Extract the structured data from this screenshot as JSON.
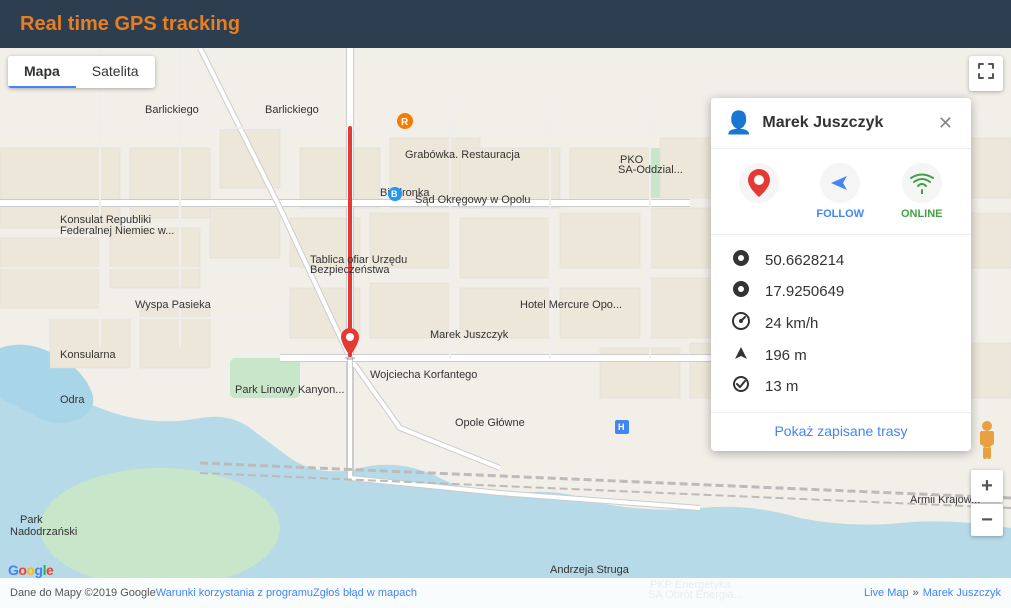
{
  "header": {
    "title": "Real time GPS tracking"
  },
  "map_tabs": [
    {
      "label": "Mapa",
      "active": true
    },
    {
      "label": "Satelita",
      "active": false
    }
  ],
  "info_panel": {
    "user_name": "Marek Juszczyk",
    "actions": [
      {
        "id": "location",
        "icon": "📍",
        "label": ""
      },
      {
        "id": "follow",
        "icon": "➤",
        "label": "FOLLOW"
      },
      {
        "id": "online",
        "icon": "📶",
        "label": "ONLINE"
      }
    ],
    "stats": [
      {
        "icon": "📍",
        "value": "50.6628214"
      },
      {
        "icon": "📍",
        "value": "17.9250649"
      },
      {
        "icon": "🏎",
        "value": "24 km/h"
      },
      {
        "icon": "▲",
        "value": "196 m"
      },
      {
        "icon": "✔",
        "value": "13 m"
      }
    ],
    "footer_link": "Pokaż zapisane trasy"
  },
  "breadcrumb": {
    "live_map_label": "Live Map",
    "separator": "»",
    "user_label": "Marek Juszczyk"
  },
  "bottom_bar": {
    "copyright": "Dane do Mapy ©2019 Google",
    "terms": "Warunki korzystania z programu",
    "report": "Zgłoś błąd w mapach"
  },
  "map_marker_label": "Marek Juszczyk",
  "colors": {
    "accent": "#e67e22",
    "header_bg": "#2c3e50",
    "route": "#e53935",
    "follow_blue": "#4285f4",
    "online_green": "#43a047"
  }
}
